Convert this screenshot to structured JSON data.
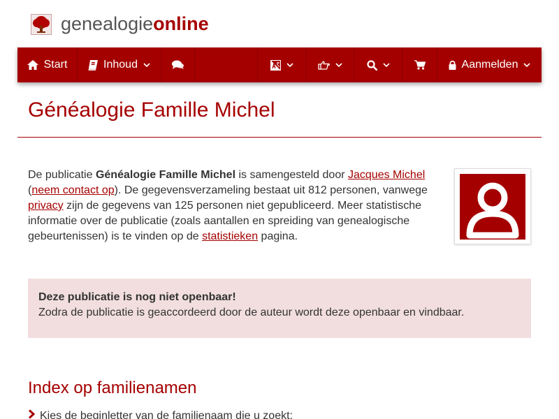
{
  "brand": {
    "name_part1": "genealogie",
    "name_part2": "online"
  },
  "nav": {
    "start": "Start",
    "contents": "Inhoud",
    "login": "Aanmelden"
  },
  "page": {
    "title": "Généalogie Famille Michel"
  },
  "intro": {
    "t1": "De publicatie ",
    "pub_name": "Généalogie Famille Michel",
    "t2": " is samengesteld door ",
    "author_link": "Jacques Michel",
    "t3": " (",
    "contact_link": "neem contact op",
    "t4": "). De gegevensverzameling bestaat uit 812 personen, vanwege ",
    "privacy_link": "privacy",
    "t5": " zijn de gegevens van 125 personen niet gepubliceerd. Meer statistische informatie over de publicatie (zoals aantallen en spreiding van genealogische gebeurtenissen) is te vinden op de ",
    "stats_link": "statistieken",
    "t6": " pagina."
  },
  "alert": {
    "title": "Deze publicatie is nog niet openbaar!",
    "text": "Zodra de publicatie is geaccordeerd door de auteur wordt deze openbaar en vindbaar."
  },
  "index": {
    "heading": "Index op familienamen",
    "hint": "Kies de beginletter van de familienaam die u zoekt:"
  },
  "colors": {
    "brand": "#a50000",
    "alert_bg": "#f2dede"
  },
  "icons": [
    "tree-icon",
    "home-icon",
    "book-icon",
    "comments-icon",
    "language-icon",
    "hand-point-icon",
    "search-icon",
    "cart-icon",
    "lock-icon",
    "chevron-down-icon",
    "user-icon",
    "chevron-right-icon"
  ]
}
